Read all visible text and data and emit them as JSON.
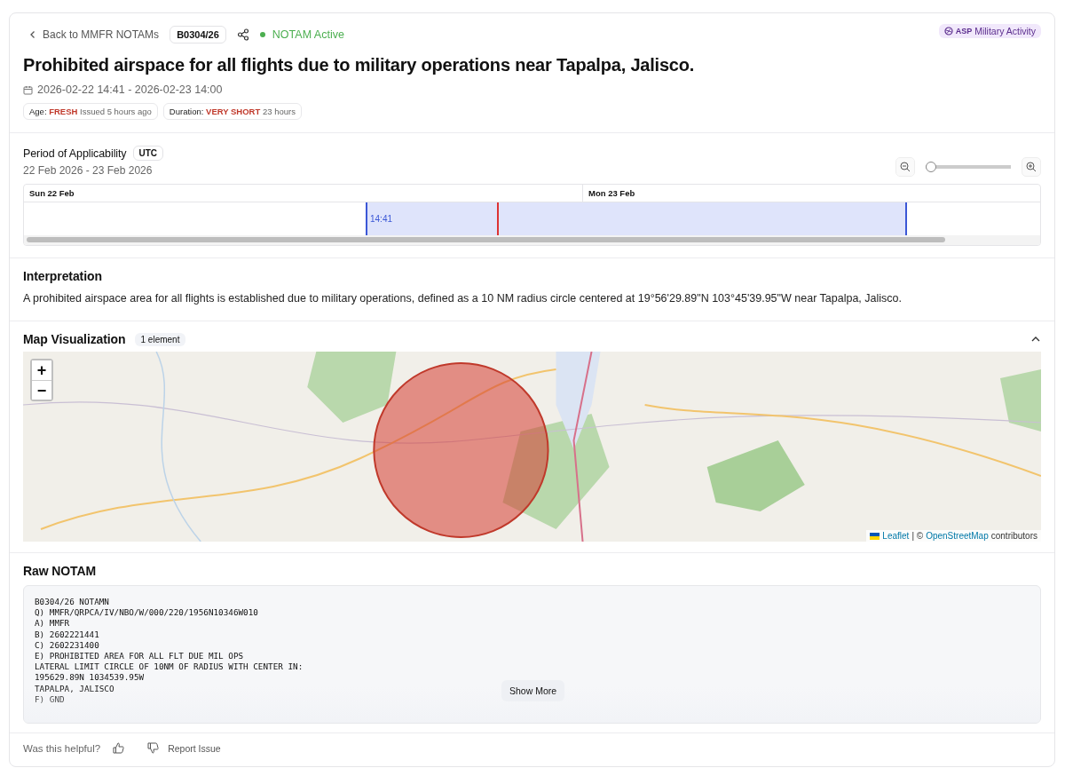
{
  "header": {
    "back_link": "Back to MMFR NOTAMs",
    "notam_id": "B0304/26",
    "status": {
      "label": "NOTAM Active",
      "active": true
    },
    "category": {
      "code": "ASP",
      "label": "Military Activity"
    },
    "title": "Prohibited airspace for all flights due to military operations near Tapalpa, Jalisco.",
    "validity": "2026-02-22 14:41 - 2026-02-23 14:00",
    "chips": [
      {
        "label": "Age:",
        "value": "FRESH",
        "detail": "Issued 5 hours ago"
      },
      {
        "label": "Duration:",
        "value": "VERY SHORT",
        "detail": "23 hours"
      }
    ]
  },
  "period": {
    "title": "Period of Applicability",
    "timezone": "UTC",
    "range": "22 Feb 2026 - 23 Feb 2026",
    "zoom": {
      "level": 0
    },
    "days": [
      {
        "label": "Sun 22 Feb"
      },
      {
        "label": "Mon 23 Feb"
      }
    ],
    "start_label": "14:41"
  },
  "interpretation": {
    "title": "Interpretation",
    "text": "A prohibited airspace area for all flights is established due to military operations, defined as a 10 NM radius circle centered at 19°56'29.89\"N 103°45'39.95\"W near Tapalpa, Jalisco."
  },
  "map": {
    "title": "Map Visualization",
    "count": "1 element",
    "expanded": true,
    "zoom_in": "+",
    "zoom_out": "−",
    "attribution": {
      "leaflet": "Leaflet",
      "separator": "| ©",
      "osm": "OpenStreetMap",
      "rest": "contributors"
    }
  },
  "raw": {
    "title": "Raw NOTAM",
    "lines": [
      "B0304/26 NOTAMN",
      "Q) MMFR/QRPCA/IV/NBO/W/000/220/1956N10346W010",
      "A) MMFR",
      "B) 2602221441",
      "C) 2602231400",
      "E) PROHIBITED AREA FOR ALL FLT DUE MIL OPS",
      "LATERAL LIMIT CIRCLE OF 10NM OF RADIUS WITH CENTER IN:",
      "195629.89N 1034539.95W",
      "TAPALPA, JALISCO",
      "F) GND"
    ],
    "show_more": "Show More"
  },
  "footer": {
    "question": "Was this helpful?",
    "report": "Report Issue"
  }
}
